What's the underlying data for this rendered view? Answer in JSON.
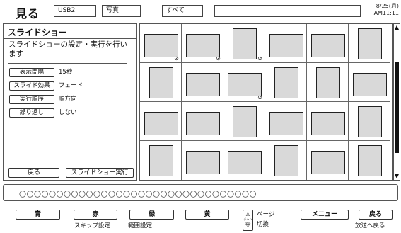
{
  "header": {
    "title": "見る",
    "breadcrumbs": [
      "USB2",
      "写真",
      "すべて",
      ""
    ],
    "date": "8/25(月)",
    "time": "AM11:11"
  },
  "panel": {
    "title": "スライドショー",
    "description": "スライドショーの設定・実行を行います",
    "settings": [
      {
        "label": "表示間隔",
        "value": "15秒"
      },
      {
        "label": "スライド効果",
        "value": "フェード"
      },
      {
        "label": "実行順序",
        "value": "順方向"
      },
      {
        "label": "繰り返し",
        "value": "しない"
      }
    ],
    "back_label": "戻る",
    "execute_label": "スライドショー実行"
  },
  "thumbnails": {
    "rows": 4,
    "cols": 6,
    "items": [
      {
        "orient": "land",
        "blocked": true
      },
      {
        "orient": "land",
        "blocked": true
      },
      {
        "orient": "port",
        "blocked": true
      },
      {
        "orient": "land",
        "blocked": false
      },
      {
        "orient": "land",
        "blocked": false
      },
      {
        "orient": "port",
        "blocked": false
      },
      {
        "orient": "port",
        "blocked": false
      },
      {
        "orient": "land",
        "blocked": false
      },
      {
        "orient": "land",
        "blocked": true
      },
      {
        "orient": "port",
        "blocked": false
      },
      {
        "orient": "port",
        "blocked": false
      },
      {
        "orient": "land",
        "blocked": false
      },
      {
        "orient": "land",
        "blocked": false
      },
      {
        "orient": "land",
        "blocked": false
      },
      {
        "orient": "port",
        "blocked": false
      },
      {
        "orient": "land",
        "blocked": false
      },
      {
        "orient": "land",
        "blocked": false
      },
      {
        "orient": "port",
        "blocked": false
      },
      {
        "orient": "port",
        "blocked": false
      },
      {
        "orient": "land",
        "blocked": false
      },
      {
        "orient": "land",
        "blocked": false
      },
      {
        "orient": "port",
        "blocked": false
      },
      {
        "orient": "land",
        "blocked": false
      },
      {
        "orient": "port",
        "blocked": false
      }
    ]
  },
  "scrollbar": {
    "position": 0.6,
    "up_icon": "triangle-up-icon",
    "down_icon": "triangle-down-icon"
  },
  "info": {
    "text": "〇〇〇〇〇〇〇〇〇〇〇〇〇〇〇〇〇〇〇〇〇〇〇〇〇〇〇〇〇〇〇〇"
  },
  "footer": {
    "blue_label": "青",
    "red_label": "赤",
    "red_sub": "スキップ設定",
    "green_label": "緑",
    "green_sub": "範囲設定",
    "yellow_label": "黄",
    "page_label": "ページ",
    "page_sub": "切換",
    "page_button_text": "チャンネル",
    "menu_label": "メニュー",
    "back_label": "戻る",
    "back_sub": "放送へ戻る"
  }
}
